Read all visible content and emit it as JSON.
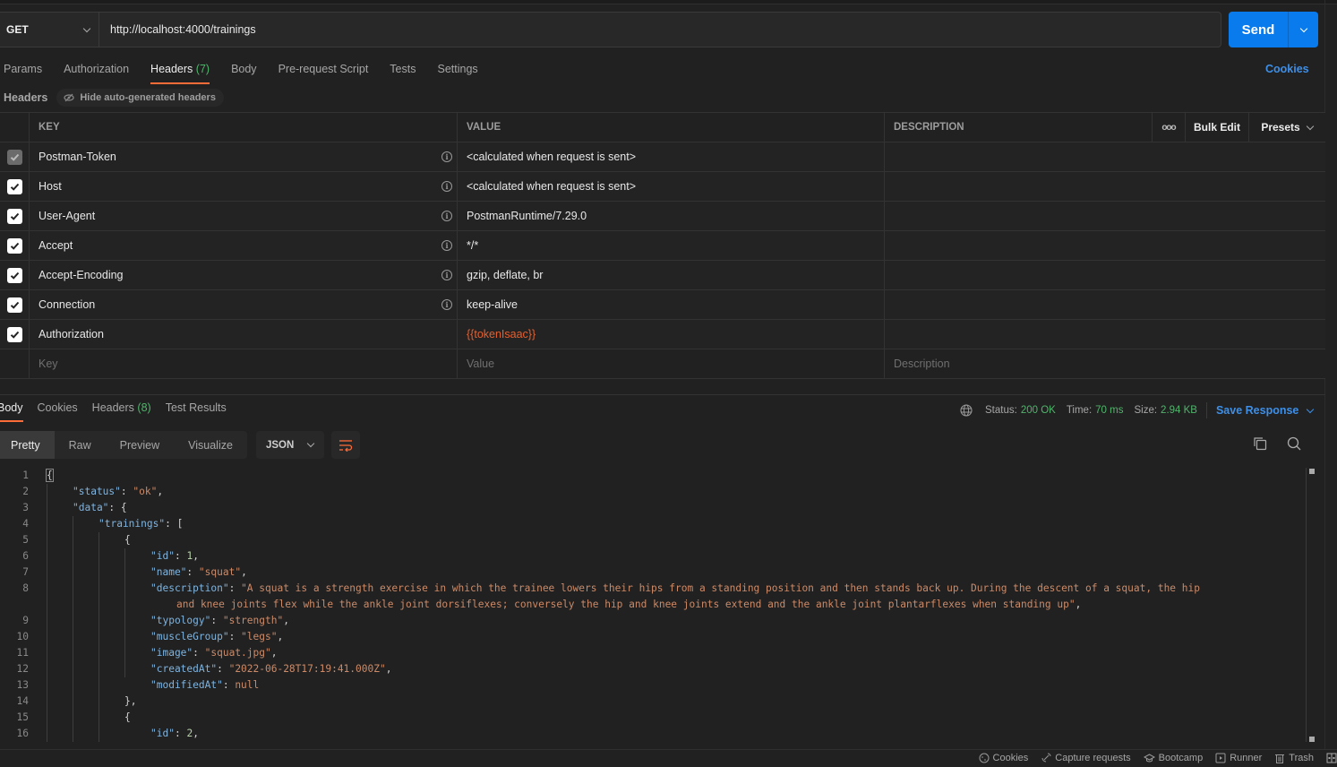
{
  "request": {
    "method": "GET",
    "url": "http://localhost:4000/trainings",
    "send_label": "Send"
  },
  "request_tabs": [
    {
      "label": "Params",
      "count": ""
    },
    {
      "label": "Authorization",
      "count": ""
    },
    {
      "label": "Headers",
      "count": "(7)"
    },
    {
      "label": "Body",
      "count": ""
    },
    {
      "label": "Pre-request Script",
      "count": ""
    },
    {
      "label": "Tests",
      "count": ""
    },
    {
      "label": "Settings",
      "count": ""
    }
  ],
  "cookies_link": "Cookies",
  "headers_section": {
    "title": "Headers",
    "hide_auto_label": "Hide auto-generated headers"
  },
  "table": {
    "columns": {
      "key": "KEY",
      "value": "VALUE",
      "description": "DESCRIPTION"
    },
    "more_label": "ooo",
    "bulk_edit_label": "Bulk Edit",
    "presets_label": "Presets",
    "rows": [
      {
        "key": "Postman-Token",
        "value": "<calculated when request is sent>",
        "checked": true,
        "disabled": true,
        "info": true
      },
      {
        "key": "Host",
        "value": "<calculated when request is sent>",
        "checked": true,
        "disabled": false,
        "info": true
      },
      {
        "key": "User-Agent",
        "value": "PostmanRuntime/7.29.0",
        "checked": true,
        "disabled": false,
        "info": true
      },
      {
        "key": "Accept",
        "value": "*/*",
        "checked": true,
        "disabled": false,
        "info": true
      },
      {
        "key": "Accept-Encoding",
        "value": "gzip, deflate, br",
        "checked": true,
        "disabled": false,
        "info": true
      },
      {
        "key": "Connection",
        "value": "keep-alive",
        "checked": true,
        "disabled": false,
        "info": true
      },
      {
        "key": "Authorization",
        "value": "{{tokenIsaac}}",
        "checked": true,
        "disabled": false,
        "info": false,
        "variable": true
      }
    ],
    "placeholders": {
      "key": "Key",
      "value": "Value",
      "description": "Description"
    }
  },
  "response": {
    "tabs": [
      {
        "label": "Body",
        "count": ""
      },
      {
        "label": "Cookies",
        "count": ""
      },
      {
        "label": "Headers",
        "count": "(8)"
      },
      {
        "label": "Test Results",
        "count": ""
      }
    ],
    "status_label": "Status:",
    "status_value": "200 OK",
    "time_label": "Time:",
    "time_value": "70 ms",
    "size_label": "Size:",
    "size_value": "2.94 KB",
    "save_label": "Save Response",
    "views": [
      "Pretty",
      "Raw",
      "Preview",
      "Visualize"
    ],
    "format": "JSON"
  },
  "code_lines": [
    {
      "n": "1",
      "indent": 0,
      "parts": [
        [
          "p",
          "{"
        ]
      ]
    },
    {
      "n": "2",
      "indent": 1,
      "parts": [
        [
          "k",
          "\"status\""
        ],
        [
          "p",
          ": "
        ],
        [
          "s",
          "\"ok\""
        ],
        [
          "p",
          ","
        ]
      ]
    },
    {
      "n": "3",
      "indent": 1,
      "parts": [
        [
          "k",
          "\"data\""
        ],
        [
          "p",
          ": {"
        ]
      ]
    },
    {
      "n": "4",
      "indent": 2,
      "parts": [
        [
          "k",
          "\"trainings\""
        ],
        [
          "p",
          ": ["
        ]
      ]
    },
    {
      "n": "5",
      "indent": 3,
      "parts": [
        [
          "p",
          "{"
        ]
      ]
    },
    {
      "n": "6",
      "indent": 4,
      "parts": [
        [
          "k",
          "\"id\""
        ],
        [
          "p",
          ": "
        ],
        [
          "n",
          "1"
        ],
        [
          "p",
          ","
        ]
      ]
    },
    {
      "n": "7",
      "indent": 4,
      "parts": [
        [
          "k",
          "\"name\""
        ],
        [
          "p",
          ": "
        ],
        [
          "s",
          "\"squat\""
        ],
        [
          "p",
          ","
        ]
      ]
    },
    {
      "n": "8",
      "indent": 4,
      "parts": [
        [
          "k",
          "\"description\""
        ],
        [
          "p",
          ": "
        ],
        [
          "s",
          "\"A squat is a strength exercise in which the trainee lowers their hips from a standing position and then stands back up. During the descent of a squat, the hip"
        ]
      ]
    },
    {
      "n": "",
      "indent": 5,
      "parts": [
        [
          "s",
          "and knee joints flex while the ankle joint dorsiflexes; conversely the hip and knee joints extend and the ankle joint plantarflexes when standing up\""
        ],
        [
          "p",
          ","
        ]
      ]
    },
    {
      "n": "9",
      "indent": 4,
      "parts": [
        [
          "k",
          "\"typology\""
        ],
        [
          "p",
          ": "
        ],
        [
          "s",
          "\"strength\""
        ],
        [
          "p",
          ","
        ]
      ]
    },
    {
      "n": "10",
      "indent": 4,
      "parts": [
        [
          "k",
          "\"muscleGroup\""
        ],
        [
          "p",
          ": "
        ],
        [
          "s",
          "\"legs\""
        ],
        [
          "p",
          ","
        ]
      ]
    },
    {
      "n": "11",
      "indent": 4,
      "parts": [
        [
          "k",
          "\"image\""
        ],
        [
          "p",
          ": "
        ],
        [
          "s",
          "\"squat.jpg\""
        ],
        [
          "p",
          ","
        ]
      ]
    },
    {
      "n": "12",
      "indent": 4,
      "parts": [
        [
          "k",
          "\"createdAt\""
        ],
        [
          "p",
          ": "
        ],
        [
          "s",
          "\"2022-06-28T17:19:41.000Z\""
        ],
        [
          "p",
          ","
        ]
      ]
    },
    {
      "n": "13",
      "indent": 4,
      "parts": [
        [
          "k",
          "\"modifiedAt\""
        ],
        [
          "p",
          ": "
        ],
        [
          "nl",
          "null"
        ]
      ]
    },
    {
      "n": "14",
      "indent": 3,
      "parts": [
        [
          "p",
          "},"
        ]
      ]
    },
    {
      "n": "15",
      "indent": 3,
      "parts": [
        [
          "p",
          "{"
        ]
      ]
    },
    {
      "n": "16",
      "indent": 4,
      "parts": [
        [
          "k",
          "\"id\""
        ],
        [
          "p",
          ": "
        ],
        [
          "n",
          "2"
        ],
        [
          "p",
          ","
        ]
      ]
    }
  ],
  "footer": [
    {
      "label": "Cookies",
      "icon": "cookie-icon"
    },
    {
      "label": "Capture requests",
      "icon": "satellite-icon"
    },
    {
      "label": "Bootcamp",
      "icon": "graduation-cap-icon"
    },
    {
      "label": "Runner",
      "icon": "runner-icon"
    },
    {
      "label": "Trash",
      "icon": "trash-icon"
    }
  ]
}
